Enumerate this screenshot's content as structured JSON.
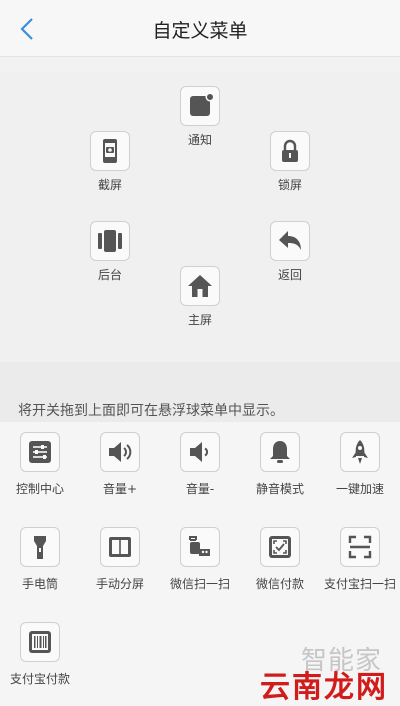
{
  "header": {
    "title": "自定义菜单"
  },
  "menu": {
    "notify": "通知",
    "screenshot": "截屏",
    "lock": "锁屏",
    "background": "后台",
    "back": "返回",
    "home": "主屏"
  },
  "hint": "将开关拖到上面即可在悬浮球菜单中显示。",
  "toggles": {
    "control_center": "控制中心",
    "volume_up": "音量+",
    "volume_down": "音量-",
    "silent": "静音模式",
    "boost": "一键加速",
    "flashlight": "手电筒",
    "split": "手动分屏",
    "wechat_scan": "微信扫一扫",
    "wechat_pay": "微信付款",
    "alipay_scan": "支付宝扫一扫",
    "alipay_pay": "支付宝付款"
  },
  "watermark": {
    "top": "智能家",
    "main": "云南龙网"
  },
  "colors": {
    "icon": "#5a5a5a",
    "accent_back": "#3b8fd9",
    "watermark_red": "#d11c1c"
  }
}
